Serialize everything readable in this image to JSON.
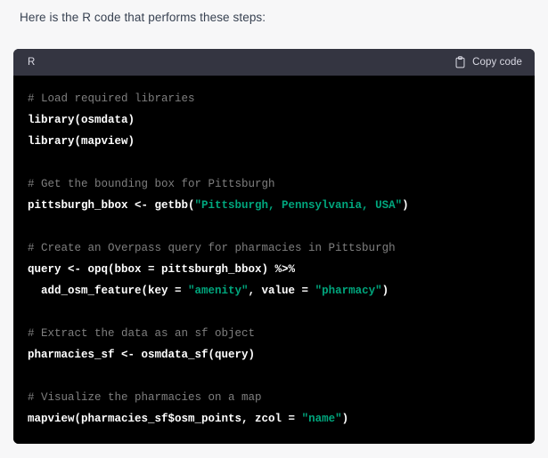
{
  "intro": {
    "text": "Here is the R code that performs these steps:"
  },
  "code_block": {
    "language_label": "R",
    "copy_label": "Copy code",
    "copy_icon": "clipboard-icon",
    "colors": {
      "header_background": "#343541",
      "body_background": "#000000",
      "comment": "#7f7f7f",
      "string": "#00a67d",
      "code": "#ffffff",
      "page_background": "#f7f7f8",
      "intro_text": "#374151"
    },
    "lines": [
      {
        "type": "comment",
        "text": "# Load required libraries"
      },
      {
        "type": "code",
        "text": "library(osmdata)"
      },
      {
        "type": "code",
        "text": "library(mapview)"
      },
      {
        "type": "blank",
        "text": ""
      },
      {
        "type": "comment",
        "text": "# Get the bounding box for Pittsburgh"
      },
      {
        "type": "mixed",
        "text": "pittsburgh_bbox <- getbb(\"Pittsburgh, Pennsylvania, USA\")"
      },
      {
        "type": "blank",
        "text": ""
      },
      {
        "type": "comment",
        "text": "# Create an Overpass query for pharmacies in Pittsburgh"
      },
      {
        "type": "code",
        "text": "query <- opq(bbox = pittsburgh_bbox) %>%"
      },
      {
        "type": "mixed",
        "text": "  add_osm_feature(key = \"amenity\", value = \"pharmacy\")"
      },
      {
        "type": "blank",
        "text": ""
      },
      {
        "type": "comment",
        "text": "# Extract the data as an sf object"
      },
      {
        "type": "code",
        "text": "pharmacies_sf <- osmdata_sf(query)"
      },
      {
        "type": "blank",
        "text": ""
      },
      {
        "type": "comment",
        "text": "# Visualize the pharmacies on a map"
      },
      {
        "type": "mixed",
        "text": "mapview(pharmacies_sf$osm_points, zcol = \"name\")"
      }
    ]
  }
}
